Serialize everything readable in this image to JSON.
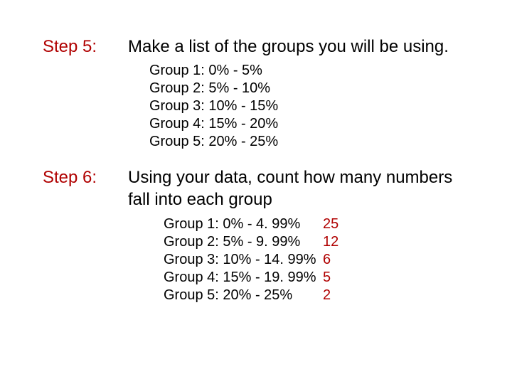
{
  "step5": {
    "label": "Step 5:",
    "text": "Make a list of the groups you will be using.",
    "groups": [
      "Group 1: 0% - 5%",
      "Group 2: 5% - 10%",
      "Group 3: 10% - 15%",
      "Group 4: 15% - 20%",
      "Group 5: 20% - 25%"
    ]
  },
  "step6": {
    "label": "Step 6:",
    "text": "Using your data, count how many numbers fall into each group",
    "groups": [
      {
        "range": "Group 1: 0% - 4. 99%",
        "count": "25"
      },
      {
        "range": "Group 2: 5% - 9. 99%",
        "count": "12"
      },
      {
        "range": "Group 3: 10% - 14. 99%",
        "count": "6"
      },
      {
        "range": "Group 4: 15% - 19. 99%",
        "count": "5"
      },
      {
        "range": "Group 5: 20% - 25%",
        "count": "2"
      }
    ]
  }
}
